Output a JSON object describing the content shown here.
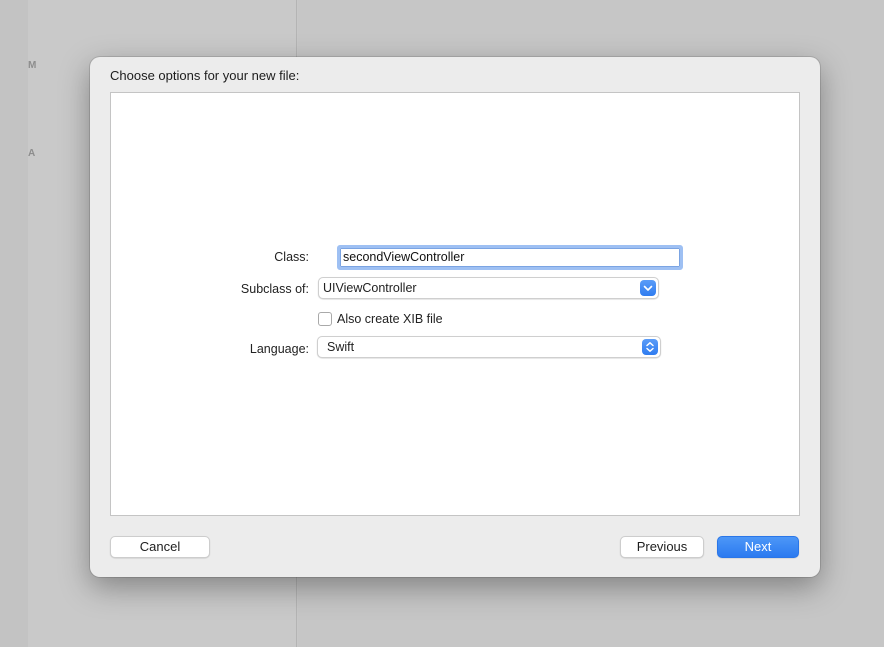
{
  "background": {
    "letters": [
      "M",
      "A"
    ]
  },
  "sheet": {
    "title": "Choose options for your new file:",
    "form": {
      "class_label": "Class:",
      "class_value": "secondViewController",
      "subclass_label": "Subclass of:",
      "subclass_value": "UIViewController",
      "xib_label": "Also create XIB file",
      "xib_checked": false,
      "language_label": "Language:",
      "language_value": "Swift"
    },
    "buttons": {
      "cancel": "Cancel",
      "previous": "Previous",
      "next": "Next"
    }
  },
  "colors": {
    "accent": "#2f7cf0",
    "focus_ring": "#9ec0f3"
  },
  "icons": {
    "subclass_popup": "chevron-down-icon",
    "language_popup": "up-down-chevron-icon"
  }
}
